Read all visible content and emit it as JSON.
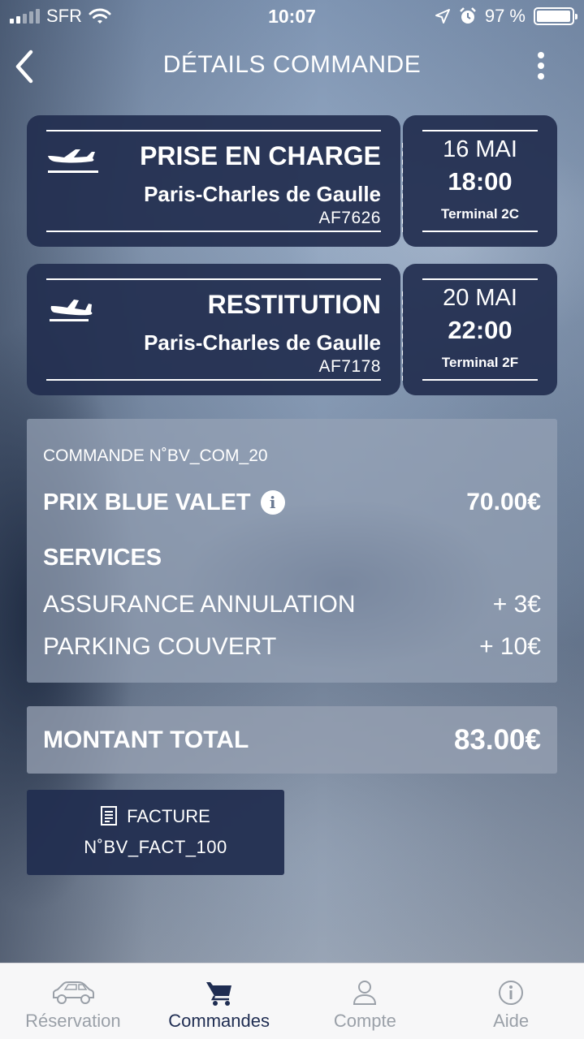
{
  "status_bar": {
    "carrier": "SFR",
    "time": "10:07",
    "battery": "97 %"
  },
  "header": {
    "title": "DÉTAILS COMMANDE",
    "back_icon": "chevron-left-icon",
    "menu_icon": "more-vertical-icon"
  },
  "pickup": {
    "label": "PRISE EN CHARGE",
    "airport": "Paris-Charles de Gaulle",
    "flight": "AF7626",
    "date": "16 MAI",
    "time": "18:00",
    "terminal": "Terminal 2C",
    "icon": "plane-takeoff-icon"
  },
  "return": {
    "label": "RESTITUTION",
    "airport": "Paris-Charles de Gaulle",
    "flight": "AF7178",
    "date": "20 MAI",
    "time": "22:00",
    "terminal": "Terminal 2F",
    "icon": "plane-landing-icon"
  },
  "order": {
    "reference": "COMMANDE N˚BV_COM_20",
    "price_label": "PRIX BLUE VALET",
    "price_value": "70.00€",
    "services_heading": "SERVICES",
    "services": [
      {
        "label": "ASSURANCE ANNULATION",
        "value": "+ 3€"
      },
      {
        "label": "PARKING COUVERT",
        "value": "+ 10€"
      }
    ]
  },
  "total": {
    "label": "MONTANT TOTAL",
    "value": "83.00€"
  },
  "invoice": {
    "label": "FACTURE",
    "number": "N˚BV_FACT_100"
  },
  "tabs": [
    {
      "label": "Réservation",
      "icon": "car-icon",
      "active": false
    },
    {
      "label": "Commandes",
      "icon": "cart-icon",
      "active": true
    },
    {
      "label": "Compte",
      "icon": "user-icon",
      "active": false
    },
    {
      "label": "Aide",
      "icon": "info-icon",
      "active": false
    }
  ],
  "colors": {
    "card": "#222e50",
    "tab_active": "#1f2d52",
    "tab_inactive": "#9aa0a8"
  }
}
